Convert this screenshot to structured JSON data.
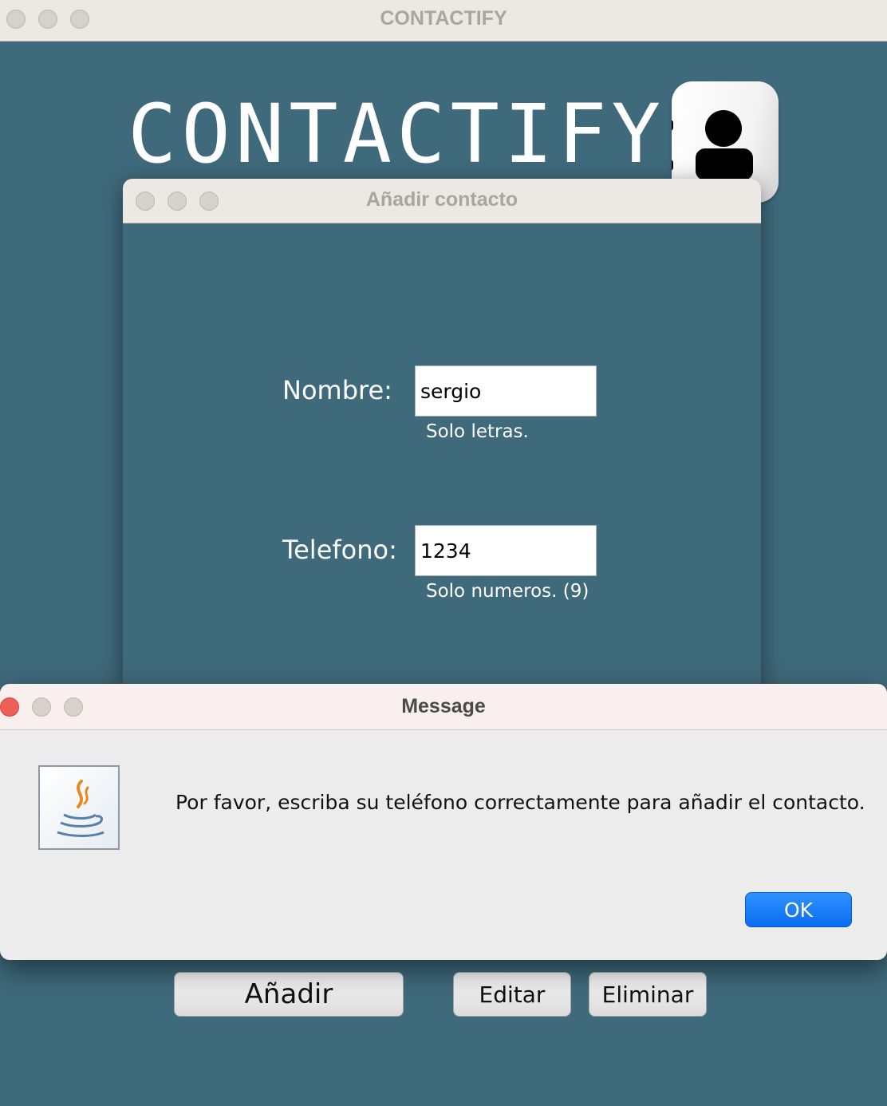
{
  "main_window": {
    "title": "CONTACTIFY"
  },
  "app": {
    "heading": "CONTACTIFY",
    "logo_icon": "contact-person-icon"
  },
  "add_dialog": {
    "title": "Añadir contacto",
    "name_label": "Nombre:",
    "name_value": "sergio",
    "name_hint": "Solo letras.",
    "phone_label": "Telefono:",
    "phone_value": "1234",
    "phone_hint": "Solo numeros. (9)"
  },
  "buttons": {
    "add": "Añadir",
    "edit": "Editar",
    "delete": "Eliminar"
  },
  "message_dialog": {
    "title": "Message",
    "icon": "java-cup-icon",
    "text": "Por favor, escriba su teléfono correctamente para añadir el contacto.",
    "ok": "OK"
  },
  "colors": {
    "background": "#3f6a7c",
    "titlebar": "#ece8e4",
    "ok_button": "#0a6ef0",
    "close_active": "#ee5f57"
  }
}
